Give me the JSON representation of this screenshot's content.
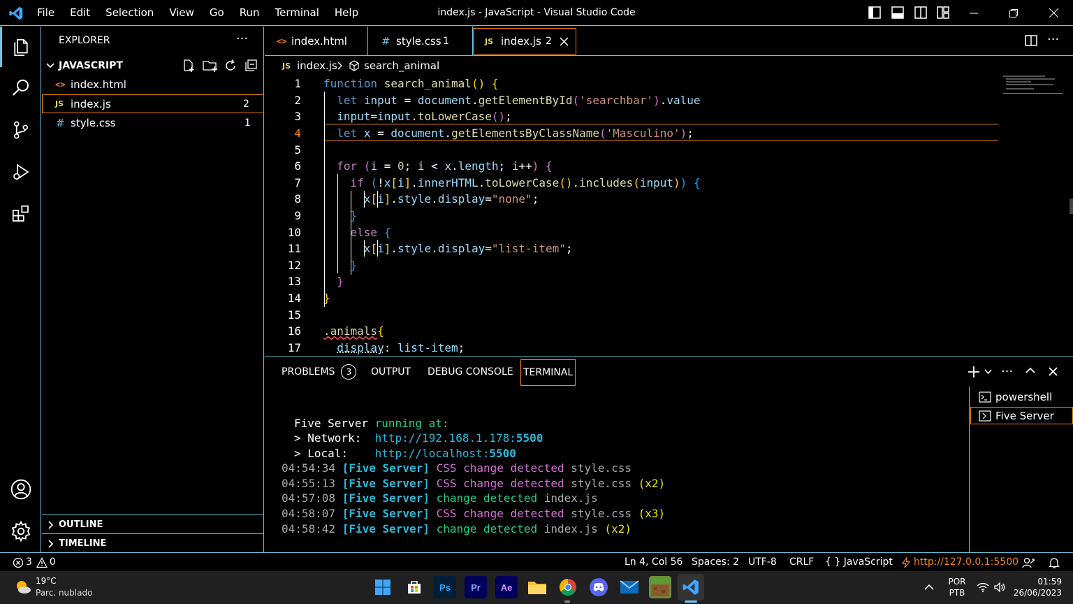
{
  "titlebar": {
    "menu": [
      "File",
      "Edit",
      "Selection",
      "View",
      "Go",
      "Run",
      "Terminal",
      "Help"
    ],
    "title": "index.js - JavaScript - Visual Studio Code"
  },
  "sidebar": {
    "header": "EXPLORER",
    "more": "···",
    "folder": "JAVASCRIPT",
    "files": [
      {
        "name": "index.html",
        "icon": "<>",
        "badge": ""
      },
      {
        "name": "index.js",
        "icon": "JS",
        "badge": "2"
      },
      {
        "name": "style.css",
        "icon": "#",
        "badge": "1"
      }
    ],
    "outline": "OUTLINE",
    "timeline": "TIMELINE"
  },
  "tabs": [
    {
      "icon": "<>",
      "label": "index.html",
      "badge": ""
    },
    {
      "icon": "#",
      "label": "style.css",
      "badge": "1"
    },
    {
      "icon": "JS",
      "label": "index.js",
      "badge": "2"
    }
  ],
  "breadcrumb": {
    "file": "index.js",
    "symbol": "search_animal"
  },
  "code": {
    "line_numbers": [
      "1",
      "2",
      "3",
      "4",
      "5",
      "6",
      "7",
      "8",
      "9",
      "10",
      "11",
      "12",
      "13",
      "14",
      "15",
      "16",
      "17"
    ]
  },
  "panel": {
    "tabs": [
      "PROBLEMS",
      "OUTPUT",
      "DEBUG CONSOLE",
      "TERMINAL"
    ],
    "problems_count": "3",
    "terminals": [
      "powershell",
      "Five Server"
    ],
    "output": {
      "server": "Five Server",
      "running": "running at:",
      "network_label": "> Network:",
      "network_url": "http://192.168.1.178:",
      "network_port": "5500",
      "local_label": "> Local:",
      "local_url": "http://localhost:",
      "local_port": "5500",
      "logs": [
        {
          "time": "04:54:34",
          "tag": "[Five Server]",
          "css": "CSS",
          "msg": "change detected",
          "file": "style.css",
          "count": ""
        },
        {
          "time": "04:55:13",
          "tag": "[Five Server]",
          "css": "CSS",
          "msg": "change detected",
          "file": "style.css",
          "count": "(x2)"
        },
        {
          "time": "04:57:08",
          "tag": "[Five Server]",
          "css": "",
          "msg": "change detected",
          "file": "index.js",
          "count": ""
        },
        {
          "time": "04:58:07",
          "tag": "[Five Server]",
          "css": "CSS",
          "msg": "change detected",
          "file": "style.css",
          "count": "(x3)"
        },
        {
          "time": "04:58:42",
          "tag": "[Five Server]",
          "css": "",
          "msg": "change detected",
          "file": "index.js",
          "count": "(x2)"
        }
      ]
    }
  },
  "statusbar": {
    "errors": "3",
    "warnings": "0",
    "position": "Ln 4, Col 56",
    "spaces": "Spaces: 2",
    "encoding": "UTF-8",
    "eol": "CRLF",
    "language": "JavaScript",
    "lang_icon": "{ }",
    "server": "http://127.0.0.1:5500"
  },
  "taskbar": {
    "temp": "19°C",
    "weather": "Parc. nublado",
    "lang1": "POR",
    "lang2": "PTB",
    "time": "01:59",
    "date": "26/06/2023"
  },
  "colors": {
    "accent": "#6fc3df",
    "highlight": "#f38518"
  }
}
